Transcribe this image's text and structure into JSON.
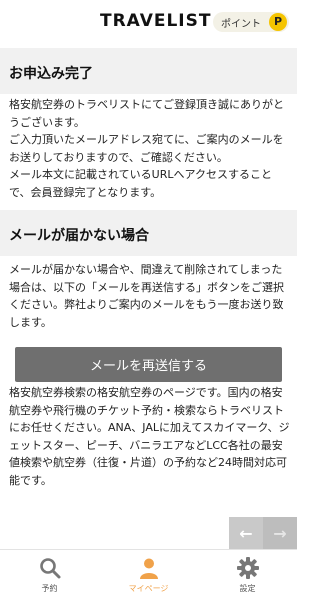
{
  "header": {
    "logo": "TRAVELIST",
    "points_label": "ポイント",
    "points_badge": "P"
  },
  "complete": {
    "title": "お申込み完了",
    "text": "格安航空券のトラベリストにてご登録頂き誠にありがとうございます。\nご入力頂いたメールアドレス宛てに、ご案内のメールをお送りしておりますので、ご確認ください。\nメール本文に記載されているURLへアクセスすることで、会員登録完了となります。"
  },
  "not_received": {
    "title": "メールが届かない場合",
    "text": "メールが届かない場合や、間違えて削除されてしまった場合は、以下の「メールを再送信する」ボタンをご選択ください。弊社よりご案内のメールをもう一度お送り致します。"
  },
  "resend_button": "メールを再送信する",
  "description": "格安航空券検索の格安航空券のページです。国内の格安航空券や飛行機のチケット予約・検索ならトラベリストにお任せください。ANA、JALに加えてスカイマーク、ジェットスター、ピーチ、バニラエアなどLCC各社の最安値検索や航空券（往復・片道）の予約など24時間対応可能です。",
  "nav_arrows": {
    "back": "←",
    "forward": "→"
  },
  "tabs": [
    {
      "label": "予約",
      "icon": "search-icon"
    },
    {
      "label": "マイページ",
      "icon": "person-icon"
    },
    {
      "label": "設定",
      "icon": "gear-icon"
    }
  ],
  "colors": {
    "accent": "#f0a24a",
    "button": "#6f6f6f",
    "badge": "#f5c400",
    "section_bg": "#f1f1f1"
  }
}
